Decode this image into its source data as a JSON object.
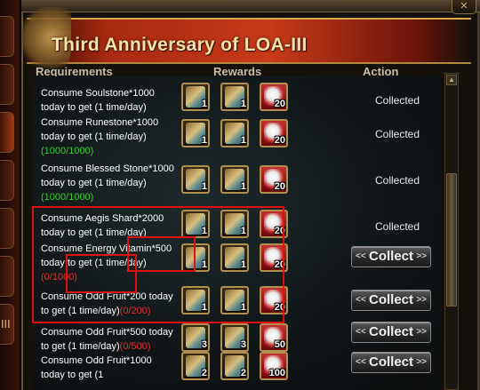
{
  "window": {
    "title": "Third Anniversary of LOA-III",
    "close_label": "✕"
  },
  "sidebar": {
    "tabs": [
      "",
      "",
      "",
      "",
      "",
      "",
      "",
      "III"
    ]
  },
  "columns": {
    "requirements": "Requirements",
    "rewards": "Rewards",
    "action": "Action"
  },
  "rows": [
    {
      "text": "Consume Soulstone*1000 today to get (1 time/day)",
      "progress": "",
      "progress_color": "green",
      "rewards": [
        "1",
        "1",
        "20"
      ],
      "status": "Collected"
    },
    {
      "text": "Consume Runestone*1000 today to get (1 time/day)",
      "progress": "(1000/1000)",
      "progress_color": "green",
      "rewards": [
        "1",
        "1",
        "20"
      ],
      "status": "Collected"
    },
    {
      "text": "Consume Blessed Stone*1000 today to get (1 time/day)",
      "progress": "(1000/1000)",
      "progress_color": "green",
      "rewards": [
        "1",
        "1",
        "20"
      ],
      "status": "Collected"
    },
    {
      "text": "Consume Aegis Shard*2000 today to get (1 time/day)",
      "progress": "",
      "progress_color": "green",
      "rewards": [
        "1",
        "1",
        "20"
      ],
      "status": "Collected"
    },
    {
      "text": "Consume Energy Vitamin*500 today to get (1 time/day)",
      "progress": "(0/1000)",
      "progress_color": "red",
      "rewards": [
        "1",
        "1",
        "20"
      ],
      "status": "Collect"
    },
    {
      "text": "Consume Odd Fruit*200 today to get (1 time/day)",
      "progress": "(0/200)",
      "progress_color": "red",
      "rewards": [
        "1",
        "1",
        "20"
      ],
      "status": "Collect"
    },
    {
      "text": "Consume Odd Fruit*500 today to get (1 time/day)",
      "progress": "(0/500)",
      "progress_color": "red",
      "rewards": [
        "3",
        "3",
        "50"
      ],
      "status": "Collect"
    },
    {
      "text": "Consume Odd Fruit*1000 today to get (1",
      "progress": "",
      "progress_color": "red",
      "rewards": [
        "2",
        "2",
        "100"
      ],
      "status": "Collect"
    }
  ],
  "colors": {
    "banner": "#c83a18",
    "title": "#f4e4a8",
    "progress_ok": "#38d038",
    "progress_bad": "#e03030",
    "highlight": "#e01010"
  }
}
